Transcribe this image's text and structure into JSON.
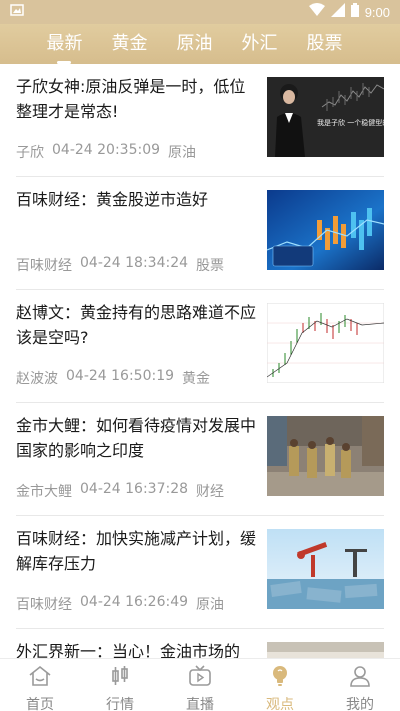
{
  "status_bar": {
    "time": "9:00"
  },
  "tabs": [
    {
      "label": "最新",
      "active": true
    },
    {
      "label": "黄金",
      "active": false
    },
    {
      "label": "原油",
      "active": false
    },
    {
      "label": "外汇",
      "active": false
    },
    {
      "label": "股票",
      "active": false
    }
  ],
  "articles": [
    {
      "title": "子欣女神:原油反弹是一时，低位整理才是常态!",
      "author": "子欣",
      "datetime": "04-24 20:35:09",
      "category": "原油",
      "thumb_caption": "我是子欣 一个稳健型的投资人"
    },
    {
      "title": "百味财经：黄金股逆市造好",
      "author": "百味财经",
      "datetime": "04-24 18:34:24",
      "category": "股票"
    },
    {
      "title": "赵博文：黄金持有的思路难道不应该是空吗?",
      "author": "赵波波",
      "datetime": "04-24 16:50:19",
      "category": "黄金"
    },
    {
      "title": "金市大鲤：如何看待疫情对发展中国家的影响之印度",
      "author": "金市大鲤",
      "datetime": "04-24 16:37:28",
      "category": "财经"
    },
    {
      "title": "百味财经：加快实施减产计划，缓解库存压力",
      "author": "百味财经",
      "datetime": "04-24 16:26:49",
      "category": "原油"
    },
    {
      "title": "外汇界新一：当心！金油市场的"
    }
  ],
  "bottom_nav": [
    {
      "label": "首页",
      "icon": "home-icon",
      "active": false
    },
    {
      "label": "行情",
      "icon": "market-icon",
      "active": false
    },
    {
      "label": "直播",
      "icon": "live-icon",
      "active": false
    },
    {
      "label": "观点",
      "icon": "bulb-icon",
      "active": true
    },
    {
      "label": "我的",
      "icon": "profile-icon",
      "active": false
    }
  ],
  "colors": {
    "header_gold": "#d9c39c",
    "active_gold": "#d9b97c",
    "meta_gray": "#999999"
  }
}
